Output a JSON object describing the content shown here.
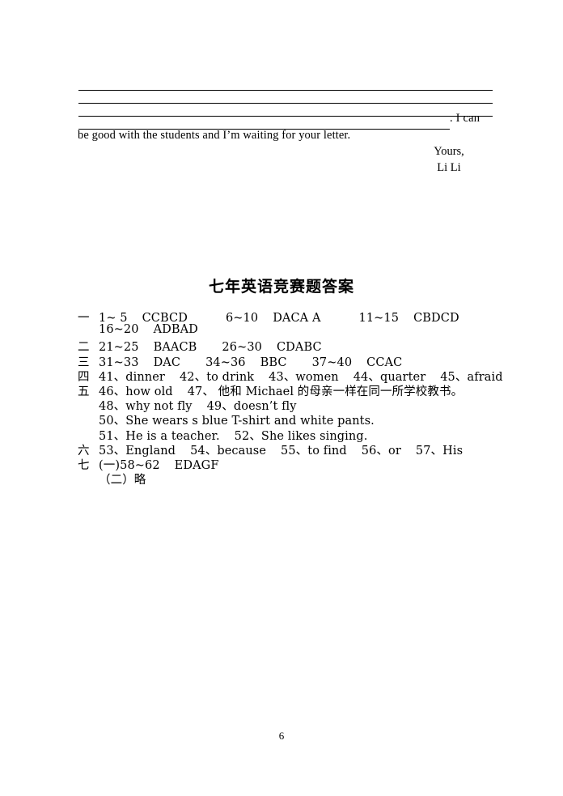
{
  "document": {
    "page_number": "6"
  },
  "letter": {
    "blank_lines": [
      {
        "style": "full"
      },
      {
        "style": "full"
      },
      {
        "style": "full"
      },
      {
        "style": "short"
      }
    ],
    "tail_text": ". I can",
    "body_text": "be good with the students and I’m waiting for your letter.",
    "closing": "Yours,",
    "signature": "Li Li"
  },
  "answer_key": {
    "title": "七年英语竞赛题答案",
    "rows": [
      {
        "marker": "一",
        "segments": [
          {
            "text": "1~ 5",
            "gap": "m"
          },
          {
            "text": "CCBCD",
            "gap": "xl"
          },
          {
            "text": "6~10",
            "gap": "m"
          },
          {
            "text": "DACA A",
            "gap": "xl"
          },
          {
            "text": "11~15",
            "gap": "m"
          },
          {
            "text": "CBDCD",
            "gap": "none"
          }
        ]
      },
      {
        "marker": "",
        "segments": [
          {
            "text": "16~20",
            "gap": "m"
          },
          {
            "text": "ADBAD",
            "gap": "none"
          }
        ]
      },
      {
        "marker": "二",
        "segments": [
          {
            "text": "21~25",
            "gap": "m"
          },
          {
            "text": "BAACB",
            "gap": "l"
          },
          {
            "text": "26~30",
            "gap": "m"
          },
          {
            "text": "CDABC",
            "gap": "none"
          }
        ]
      },
      {
        "marker": "三",
        "segments": [
          {
            "text": "31~33",
            "gap": "m"
          },
          {
            "text": "DAC",
            "gap": "l"
          },
          {
            "text": "34~36",
            "gap": "m"
          },
          {
            "text": "BBC",
            "gap": "l"
          },
          {
            "text": "37~40",
            "gap": "m"
          },
          {
            "text": "CCAC",
            "gap": "none"
          }
        ]
      },
      {
        "marker": "四",
        "segments": [
          {
            "text": "41、dinner",
            "gap": "m"
          },
          {
            "text": "42、to drink",
            "gap": "m"
          },
          {
            "text": "43、women",
            "gap": "m"
          },
          {
            "text": "44、quarter",
            "gap": "m"
          },
          {
            "text": "45、afraid",
            "gap": "none"
          }
        ]
      },
      {
        "marker": "五",
        "segments": [
          {
            "text": "46、how old",
            "gap": "m"
          },
          {
            "text": "47、 他和 Michael 的母亲一样在同一所学校教书。",
            "gap": "none"
          }
        ]
      },
      {
        "marker": "",
        "segments": [
          {
            "text": "48、why not fly",
            "gap": "m"
          },
          {
            "text": "49、doesn’t fly",
            "gap": "none"
          }
        ]
      },
      {
        "marker": "",
        "segments": [
          {
            "text": "50、She wears s blue T-shirt and white pants.",
            "gap": "none"
          }
        ]
      },
      {
        "marker": "",
        "segments": [
          {
            "text": "51、He is a teacher.",
            "gap": "m"
          },
          {
            "text": "52、She likes singing.",
            "gap": "none"
          }
        ]
      },
      {
        "marker": "六",
        "segments": [
          {
            "text": "53、England",
            "gap": "m"
          },
          {
            "text": "54、because",
            "gap": "m"
          },
          {
            "text": "55、to find",
            "gap": "m"
          },
          {
            "text": "56、or",
            "gap": "m"
          },
          {
            "text": "57、His",
            "gap": "none"
          }
        ]
      },
      {
        "marker": "七",
        "segments": [
          {
            "text": "(一)58~62",
            "gap": "m"
          },
          {
            "text": "EDAGF",
            "gap": "none"
          }
        ]
      },
      {
        "marker": "",
        "segments": [
          {
            "text": "（二）略",
            "gap": "none"
          }
        ]
      }
    ]
  }
}
